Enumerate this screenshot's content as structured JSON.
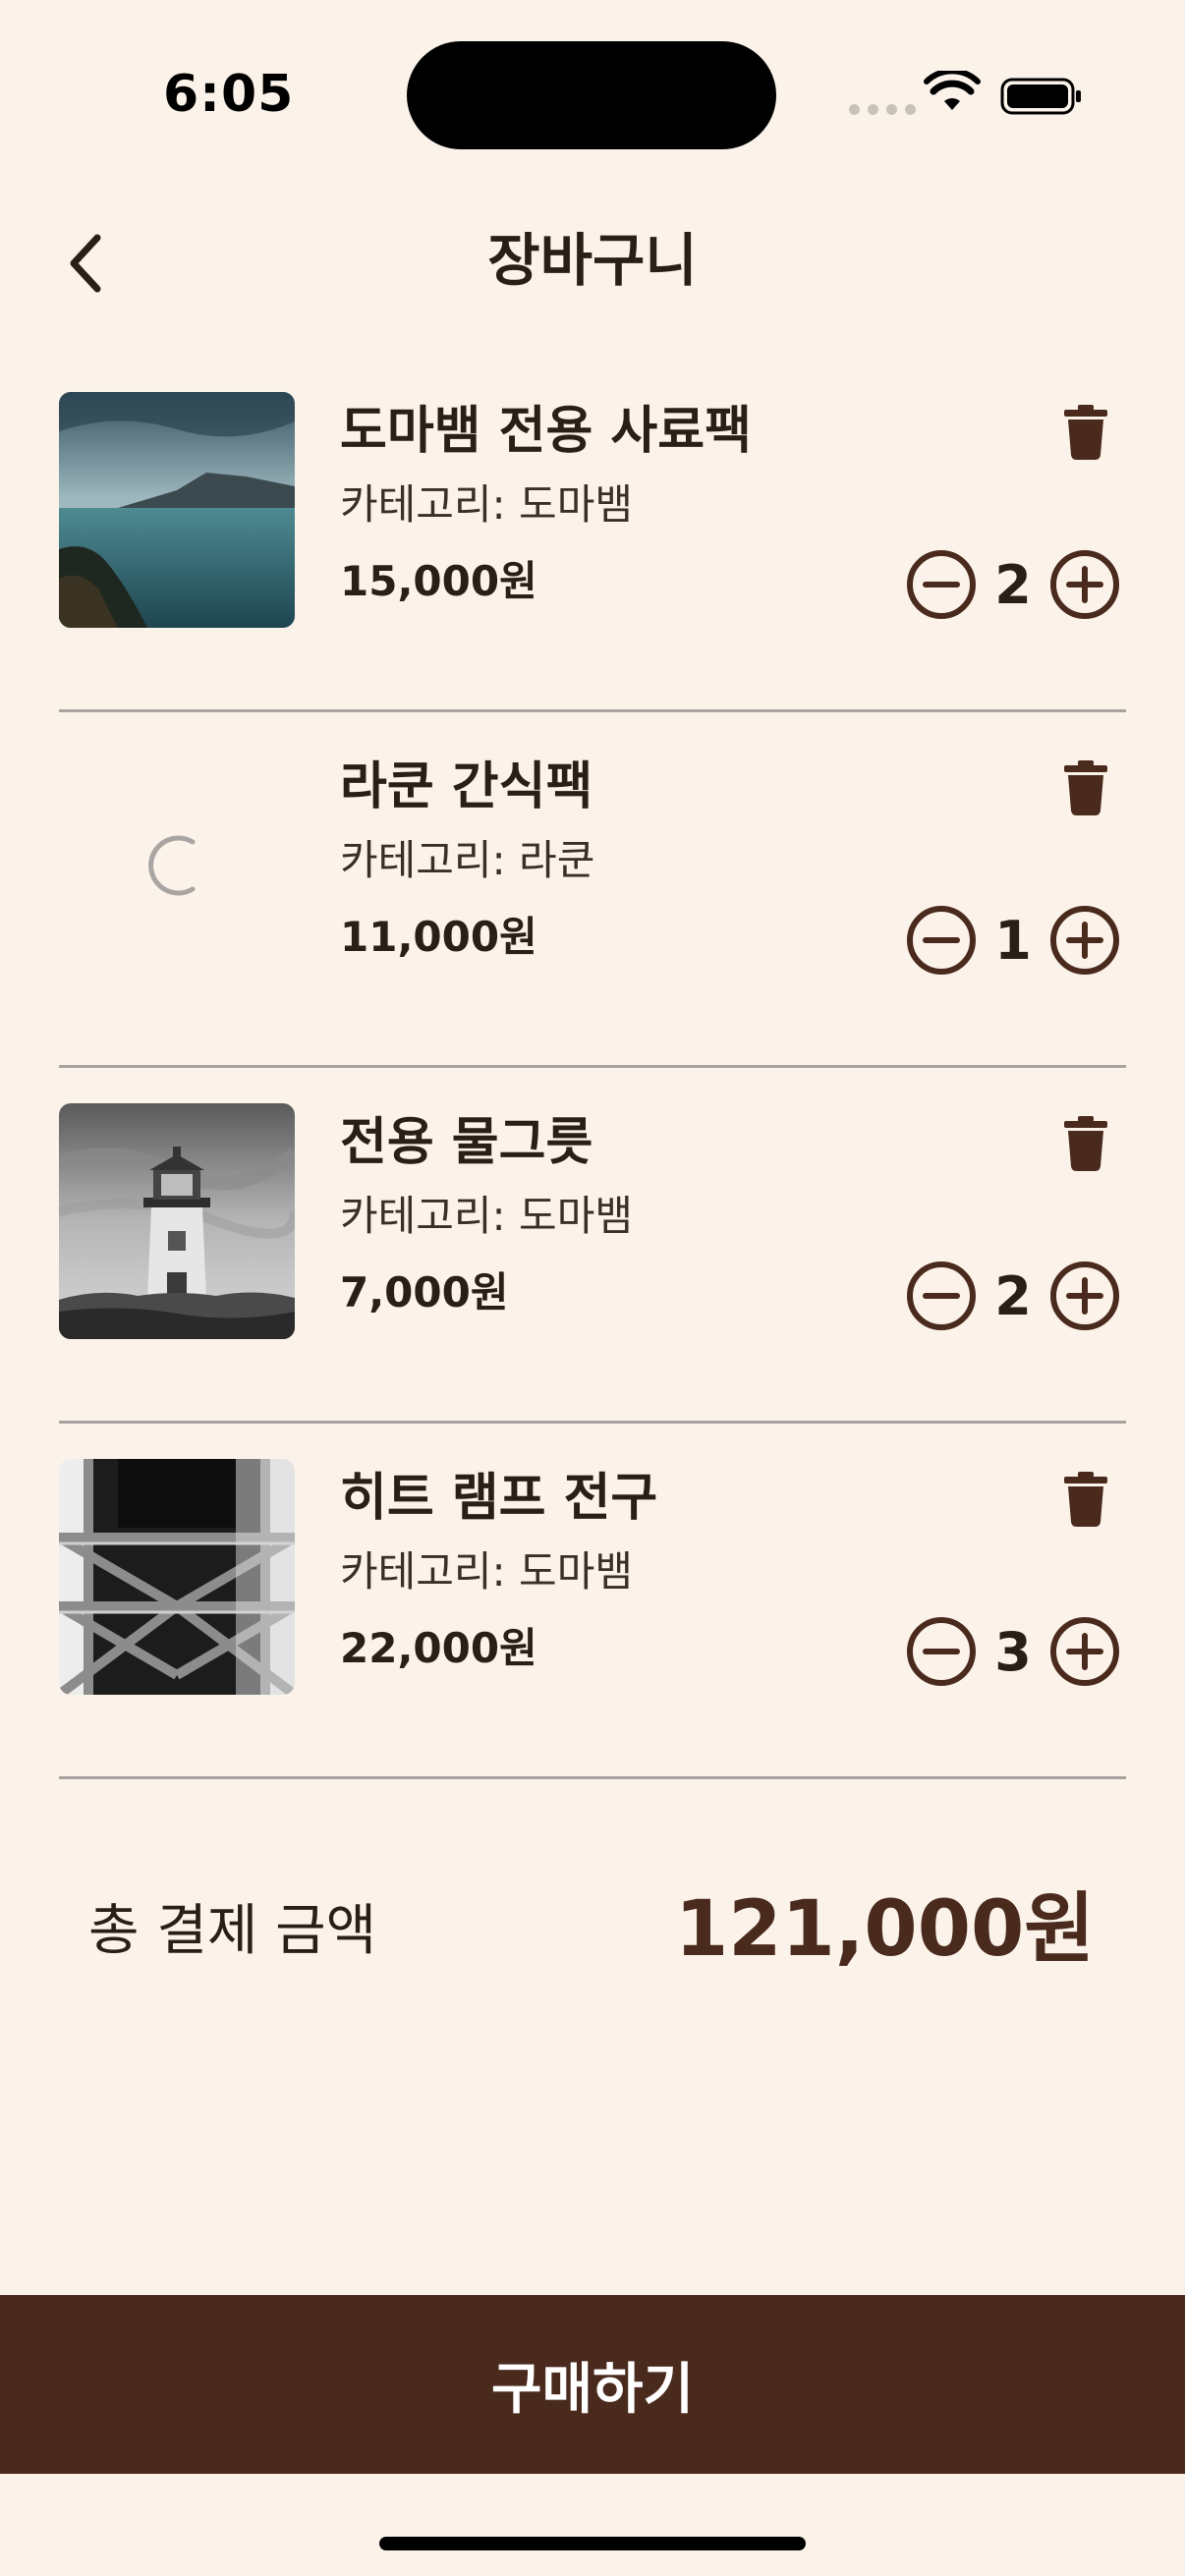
{
  "status_bar": {
    "time": "6:05"
  },
  "header": {
    "title": "장바구니",
    "back_icon": "chevron-left-icon"
  },
  "cart": {
    "items": [
      {
        "name": "도마뱀 전용 사료팩",
        "category": "카테고리: 도마뱀",
        "price": "15,000원",
        "quantity": "2",
        "image": "lake-mountain-photo"
      },
      {
        "name": "라쿤 간식팩",
        "category": "카테고리: 라쿤",
        "price": "11,000원",
        "quantity": "1",
        "image": "loading-spinner"
      },
      {
        "name": "전용 물그릇",
        "category": "카테고리: 도마뱀",
        "price": "7,000원",
        "quantity": "2",
        "image": "lighthouse-photo"
      },
      {
        "name": "히트 램프 전구",
        "category": "카테고리: 도마뱀",
        "price": "22,000원",
        "quantity": "3",
        "image": "steel-tower-photo"
      }
    ]
  },
  "summary": {
    "total_label": "총 결제 금액",
    "total_value": "121,000원"
  },
  "footer": {
    "purchase_label": "구매하기"
  },
  "colors": {
    "background": "#FBF3EA",
    "accent": "#4A2A1D",
    "text": "#2A1E18",
    "divider": "#A8A39F"
  }
}
